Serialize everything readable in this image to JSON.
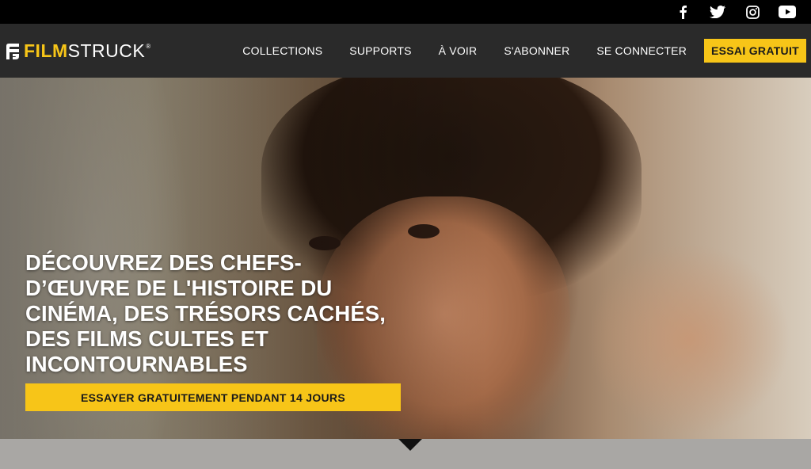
{
  "social": {
    "icons": [
      "facebook-icon",
      "twitter-icon",
      "instagram-icon",
      "youtube-icon"
    ]
  },
  "brand": {
    "logo_part1": "FILM",
    "logo_part2": "STRUCK",
    "trademark": "®"
  },
  "nav": {
    "items": [
      "COLLECTIONS",
      "SUPPORTS",
      "À VOIR",
      "S'ABONNER",
      "SE CONNECTER"
    ],
    "cta": "ESSAI GRATUIT"
  },
  "hero": {
    "headline_lines": [
      "DÉCOUVREZ DES CHEFS-",
      "D’ŒUVRE DE L'HISTOIRE DU",
      "CINÉMA, DES TRÉSORS CACHÉS,",
      "DES FILMS CULTES ET",
      "INCONTOURNABLES"
    ],
    "cta": "ESSAYER GRATUITEMENT PENDANT 14 JOURS"
  },
  "colors": {
    "accent": "#f7c518",
    "nav_bg": "#2a2a2a",
    "top_bar_bg": "#000000",
    "band_bg": "#a9a7a4"
  }
}
